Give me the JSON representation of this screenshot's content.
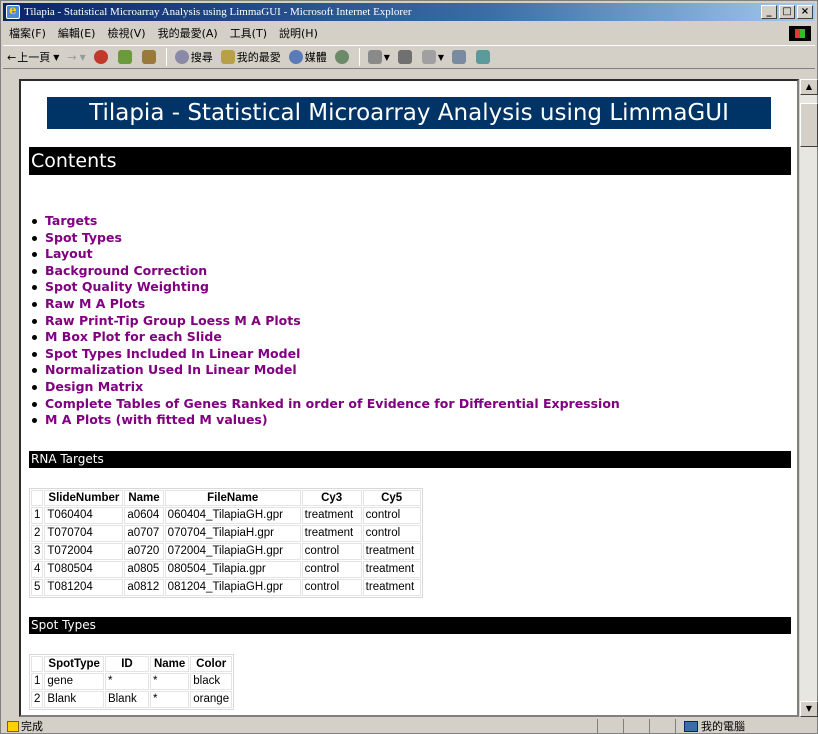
{
  "window": {
    "title": "Tilapia - Statistical Microarray Analysis using LimmaGUI - Microsoft Internet Explorer",
    "minimize": "_",
    "maximize": "□",
    "close": "×"
  },
  "menu": [
    "檔案(F)",
    "編輯(E)",
    "檢視(V)",
    "我的最愛(A)",
    "工具(T)",
    "說明(H)"
  ],
  "toolbar": {
    "back": "上一頁",
    "search": "搜尋",
    "favorites": "我的最愛",
    "media": "媒體"
  },
  "page": {
    "banner": "Tilapia - Statistical Microarray Analysis using LimmaGUI",
    "contents_title": "Contents",
    "toc": [
      "Targets",
      "Spot Types",
      "Layout",
      "Background Correction",
      "Spot Quality Weighting",
      "Raw M A Plots",
      "Raw Print-Tip Group Loess M A Plots",
      "M Box Plot for each Slide",
      "Spot Types Included In Linear Model",
      "Normalization Used In Linear Model",
      "Design Matrix",
      "Complete Tables of Genes Ranked in order of Evidence for Differential Expression",
      "M A Plots (with fitted M values)"
    ],
    "rna_targets": {
      "title": "RNA Targets",
      "headers": [
        "",
        "SlideNumber",
        "Name",
        "FileName",
        "Cy3",
        "Cy5"
      ],
      "rows": [
        [
          "1",
          "T060404",
          "a0604",
          "060404_TilapiaGH.gpr",
          "treatment",
          "control"
        ],
        [
          "2",
          "T070704",
          "a0707",
          "070704_TilapiaH.gpr",
          "treatment",
          "control"
        ],
        [
          "3",
          "T072004",
          "a0720",
          "072004_TilapiaGH.gpr",
          "control",
          "treatment"
        ],
        [
          "4",
          "T080504",
          "a0805",
          "080504_Tilapia.gpr",
          "control",
          "treatment"
        ],
        [
          "5",
          "T081204",
          "a0812",
          "081204_TilapiaGH.gpr",
          "control",
          "treatment"
        ]
      ]
    },
    "spot_types": {
      "title": "Spot Types",
      "headers": [
        "",
        "SpotType",
        "ID",
        "Name",
        "Color"
      ],
      "rows": [
        [
          "1",
          "gene",
          "*",
          "*",
          "black"
        ],
        [
          "2",
          "Blank",
          "Blank",
          "*",
          "orange"
        ]
      ]
    }
  },
  "status": {
    "text": "完成",
    "zone": "我的電腦"
  },
  "colors": {
    "banner_bg": "#003366",
    "link": "#800080",
    "section_bg": "#000000"
  }
}
